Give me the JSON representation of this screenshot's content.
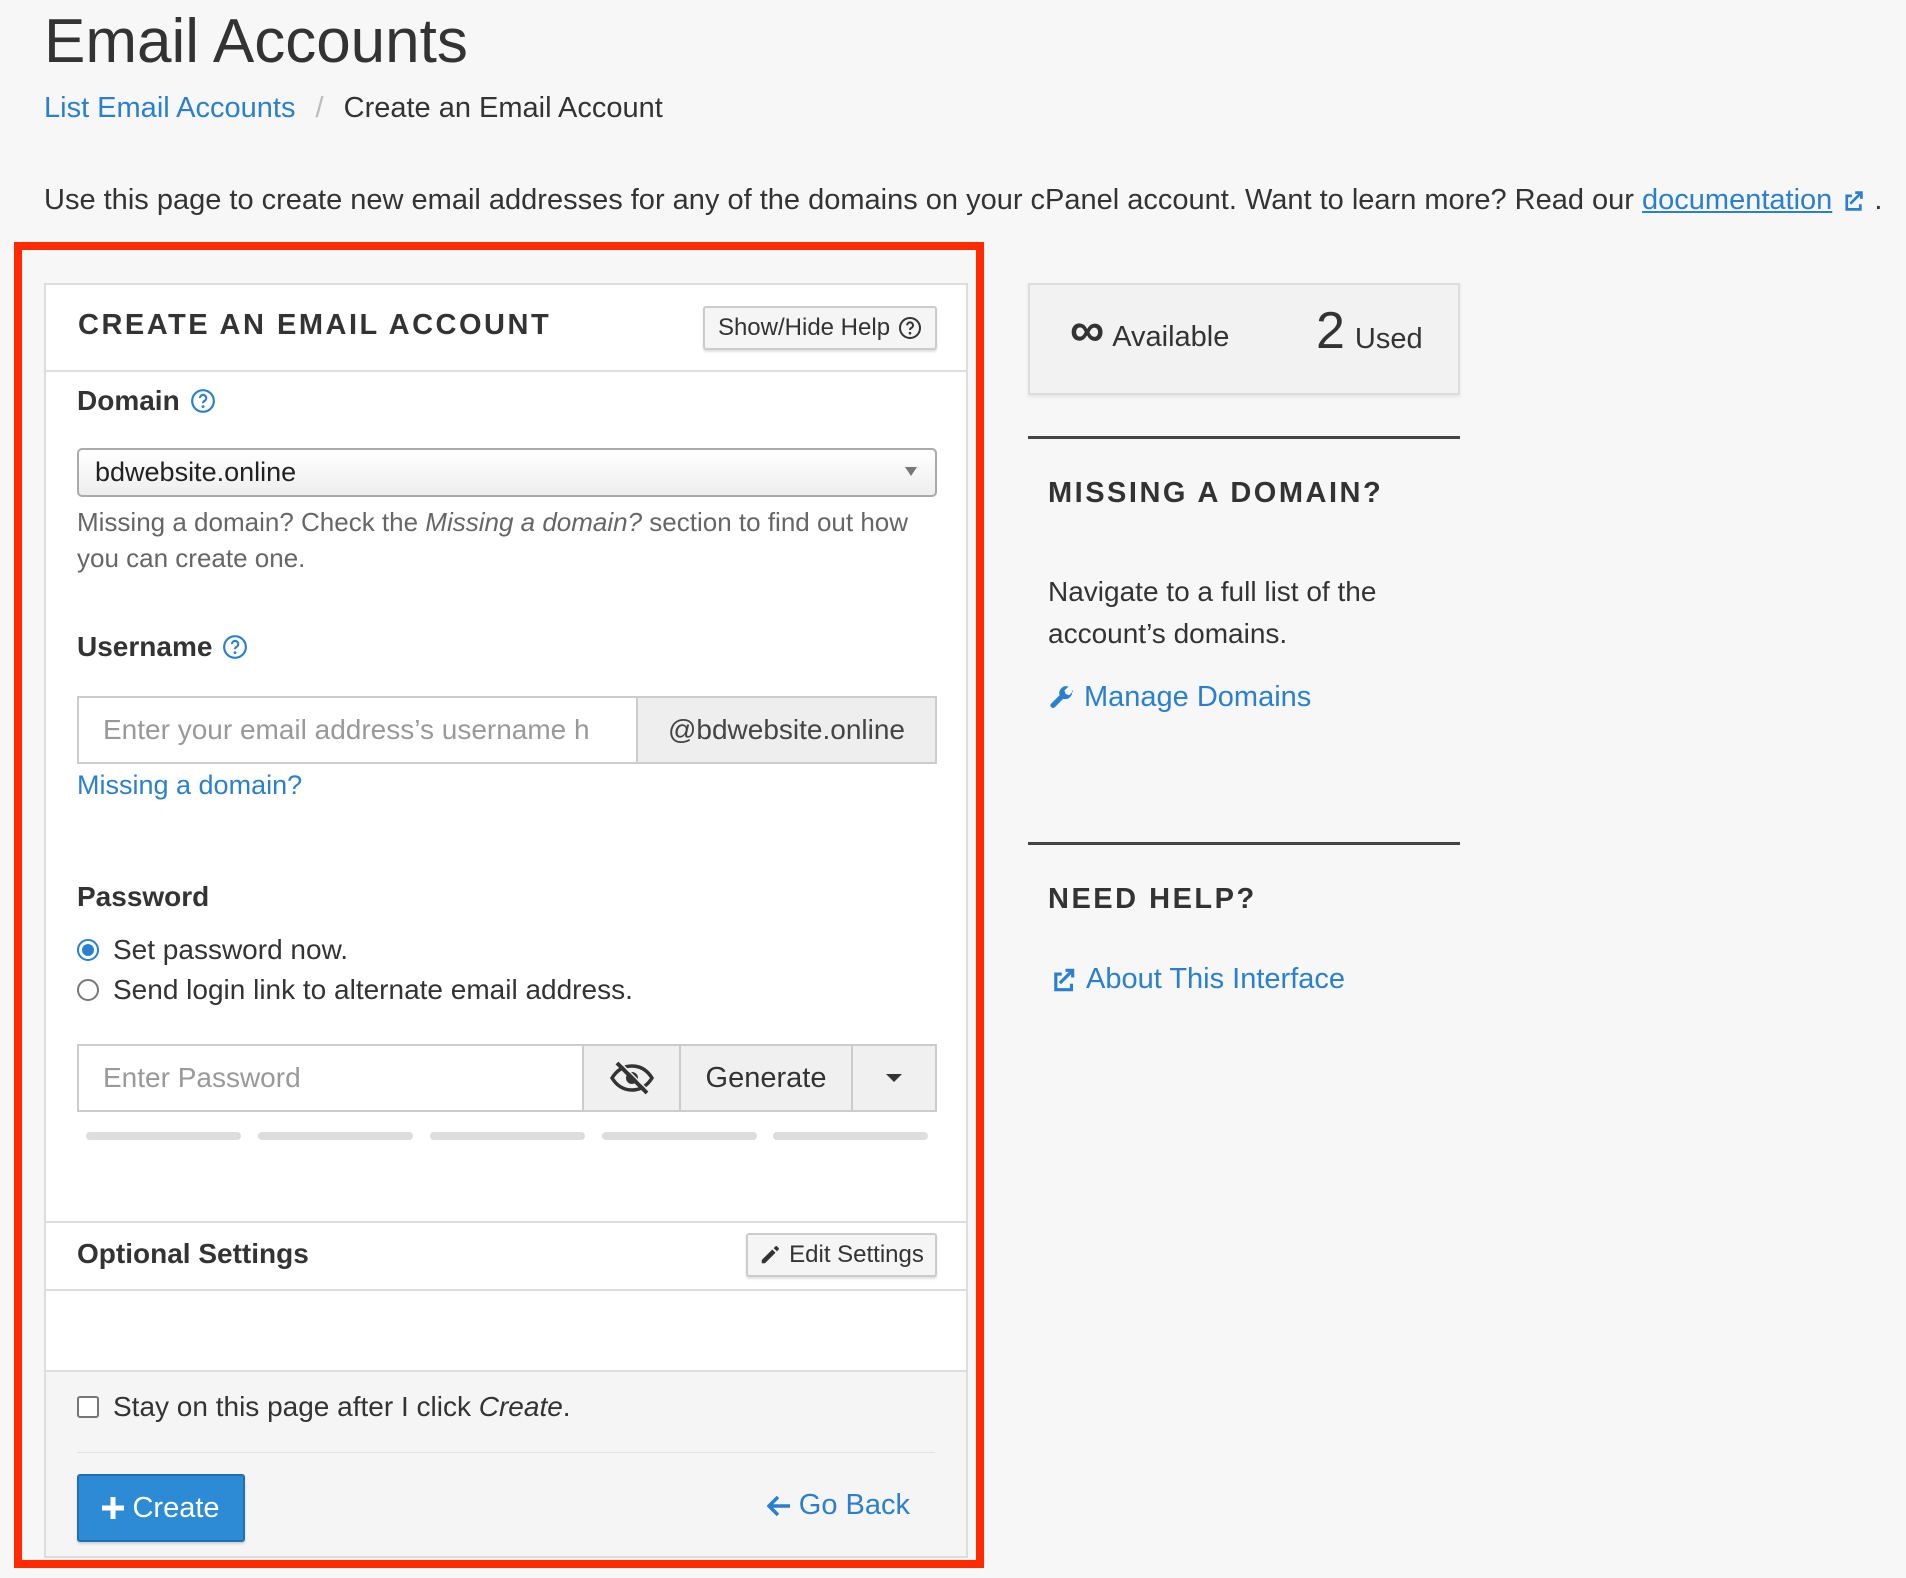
{
  "page": {
    "title": "Email Accounts",
    "breadcrumb": {
      "parent": "List Email Accounts",
      "separator": "/",
      "current": "Create an Email Account"
    },
    "intro": {
      "text": "Use this page to create new email addresses for any of the domains on your cPanel account. Want to learn more? Read our",
      "link": "documentation",
      "suffix": "."
    }
  },
  "form": {
    "title": "CREATE AN EMAIL ACCOUNT",
    "show_hide_help": "Show/Hide Help",
    "domain": {
      "label": "Domain",
      "selected": "bdwebsite.online",
      "help_prefix": "Missing a domain? Check the ",
      "help_em": "Missing a domain?",
      "help_suffix": " section to find out how you can create one."
    },
    "username": {
      "label": "Username",
      "placeholder": "Enter your email address’s username h",
      "suffix": "@bdwebsite.online",
      "missing_link": "Missing a domain?"
    },
    "password": {
      "label": "Password",
      "option_set_now": "Set password now.",
      "option_send_link": "Send login link to alternate email address.",
      "placeholder": "Enter Password",
      "generate": "Generate"
    },
    "optional": {
      "title": "Optional Settings",
      "edit": "Edit Settings"
    },
    "footer": {
      "stay_prefix": "Stay on this page after I click ",
      "stay_em": "Create",
      "stay_suffix": ".",
      "create": "Create",
      "go_back": "Go Back"
    }
  },
  "stats": {
    "available_symbol": "∞",
    "available_label": "Available",
    "used_count": "2",
    "used_label": "Used"
  },
  "sidebar": {
    "missing_domain": {
      "title": "MISSING A DOMAIN?",
      "text": "Navigate to a full list of the account’s domains.",
      "link": "Manage Domains"
    },
    "need_help": {
      "title": "NEED HELP?",
      "link": "About This Interface"
    }
  },
  "colors": {
    "accent": "#2a7fcf",
    "primary_button": "#2d8ad5",
    "highlight_border": "#ff2a00"
  }
}
